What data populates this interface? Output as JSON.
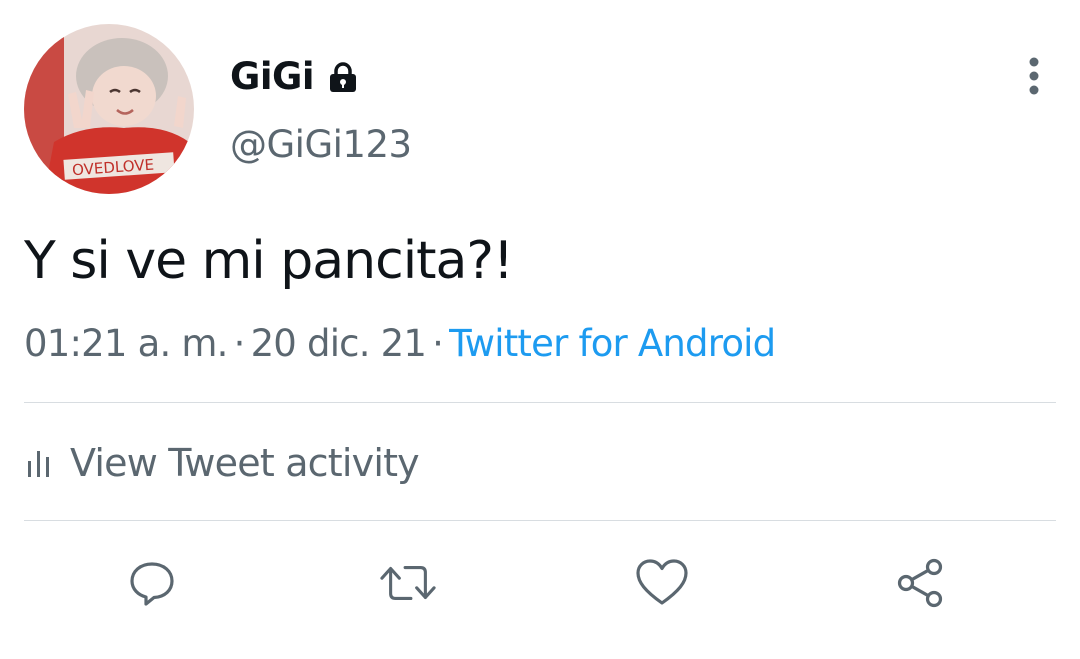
{
  "tweet": {
    "display_name": "GiGi",
    "username": "@GiGi123",
    "protected": true,
    "avatar_text": "OVEDLOVE",
    "text": "Y si ve mi pancita?!",
    "time": "01:21 a. m.",
    "date": "20 dic. 21",
    "separator": "·",
    "source": "Twitter for Android"
  },
  "activity": {
    "label": "View Tweet activity"
  },
  "actions": {
    "reply_icon": "reply-icon",
    "retweet_icon": "retweet-icon",
    "like_icon": "heart-icon",
    "share_icon": "share-icon"
  },
  "colors": {
    "text": "#0f1419",
    "secondary": "#5b6770",
    "link": "#1d9bf0",
    "divider": "#d8dde1"
  }
}
